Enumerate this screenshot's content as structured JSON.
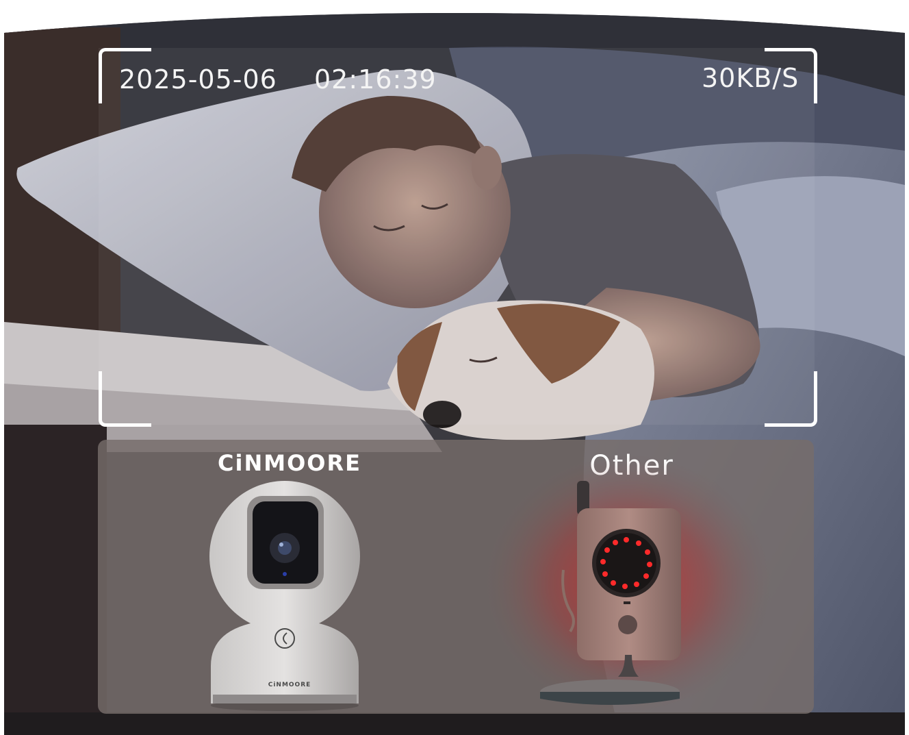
{
  "overlay": {
    "date": "2025-05-06",
    "time": "02:16:39",
    "bitrate": "30KB/S"
  },
  "comparison": {
    "brand_label": "CiNMOORE",
    "other_label": "Other",
    "camera_brand_marking": "CiNMOORE"
  },
  "colors": {
    "hud_text": "#f4f4f4",
    "panel": "#766c6a",
    "ir_glow": "#c8282a"
  },
  "icons": [
    "viewfinder-corner-icon",
    "moon-icon",
    "ir-led-ring-icon"
  ]
}
